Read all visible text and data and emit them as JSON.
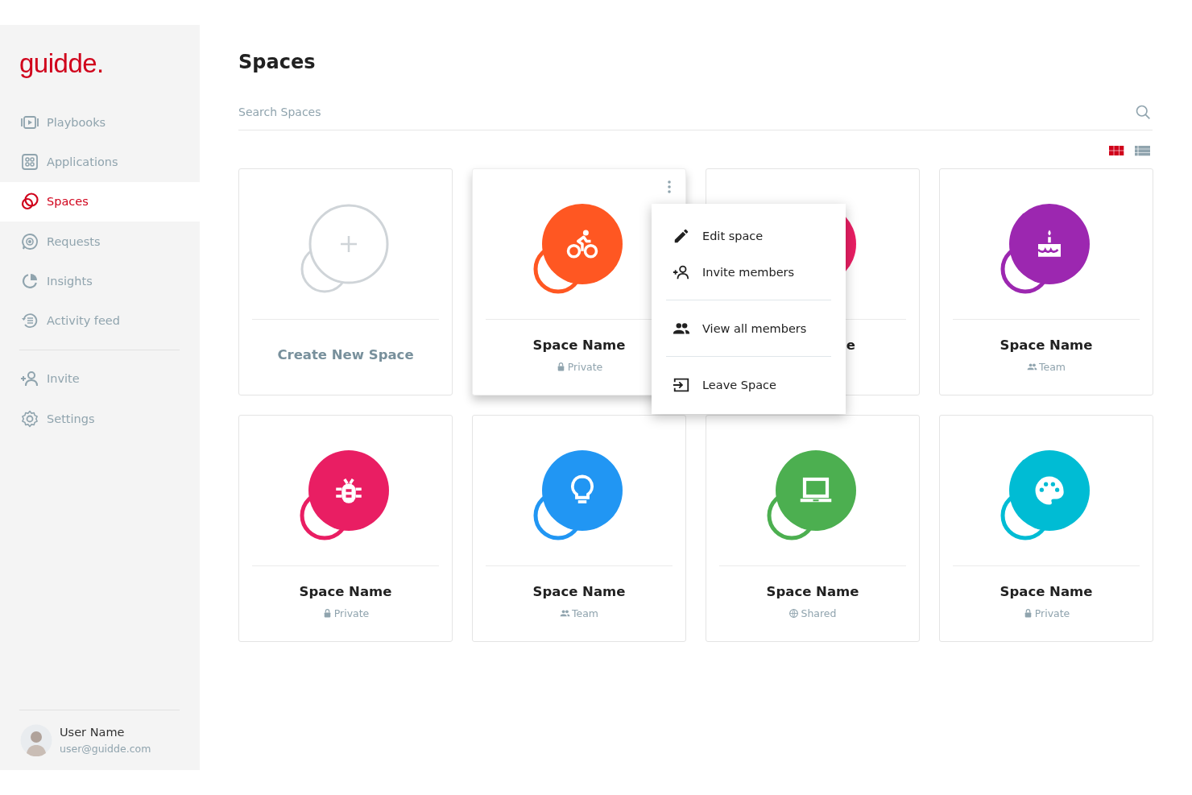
{
  "sidebar": {
    "logo": "guidde.",
    "items": [
      {
        "label": "Playbooks",
        "selected": false
      },
      {
        "label": "Applications",
        "selected": false
      },
      {
        "label": "Spaces",
        "selected": true
      },
      {
        "label": "Requests",
        "selected": false
      },
      {
        "label": "Insights",
        "selected": false
      },
      {
        "label": "Activity feed",
        "selected": false
      }
    ],
    "secondary_items": [
      {
        "label": "Invite"
      },
      {
        "label": "Settings"
      }
    ],
    "user": {
      "name": "User Name",
      "email": "user@guidde.com"
    }
  },
  "page_title": "Spaces",
  "search": {
    "placeholder": "Search Spaces"
  },
  "view_toggle": [
    {
      "kind": "grid",
      "selected": true
    },
    {
      "kind": "list",
      "selected": false
    }
  ],
  "cards": [
    {
      "kind": "create",
      "label": "Create New Space"
    },
    {
      "kind": "space",
      "name": "Space Name",
      "access": {
        "kind": "private",
        "label": "Private"
      },
      "color": "#ff5722",
      "menu_open": true
    },
    {
      "kind": "covered",
      "name": "e",
      "color": "#e91e63"
    },
    {
      "kind": "space",
      "name": "Space Name",
      "access": {
        "kind": "team",
        "label": "Team"
      },
      "color": "#9c27b0",
      "menu_open": false
    },
    {
      "kind": "space",
      "name": "Space Name",
      "access": {
        "kind": "private",
        "label": "Private"
      },
      "color": "#e91e63",
      "menu_open": false
    },
    {
      "kind": "space",
      "name": "Space Name",
      "access": {
        "kind": "team",
        "label": "Team"
      },
      "color": "#2196f3",
      "menu_open": false
    },
    {
      "kind": "space",
      "name": "Space Name",
      "access": {
        "kind": "shared",
        "label": "Shared"
      },
      "color": "#4caf50",
      "menu_open": false
    },
    {
      "kind": "space",
      "name": "Space Name",
      "access": {
        "kind": "private",
        "label": "Private"
      },
      "color": "#00bcd4",
      "menu_open": false
    }
  ],
  "context_menu": {
    "groups": [
      [
        {
          "label": "Edit space"
        },
        {
          "label": "Invite members"
        }
      ],
      [
        {
          "label": "View all members"
        }
      ],
      [
        {
          "label": "Leave Space"
        }
      ]
    ]
  }
}
